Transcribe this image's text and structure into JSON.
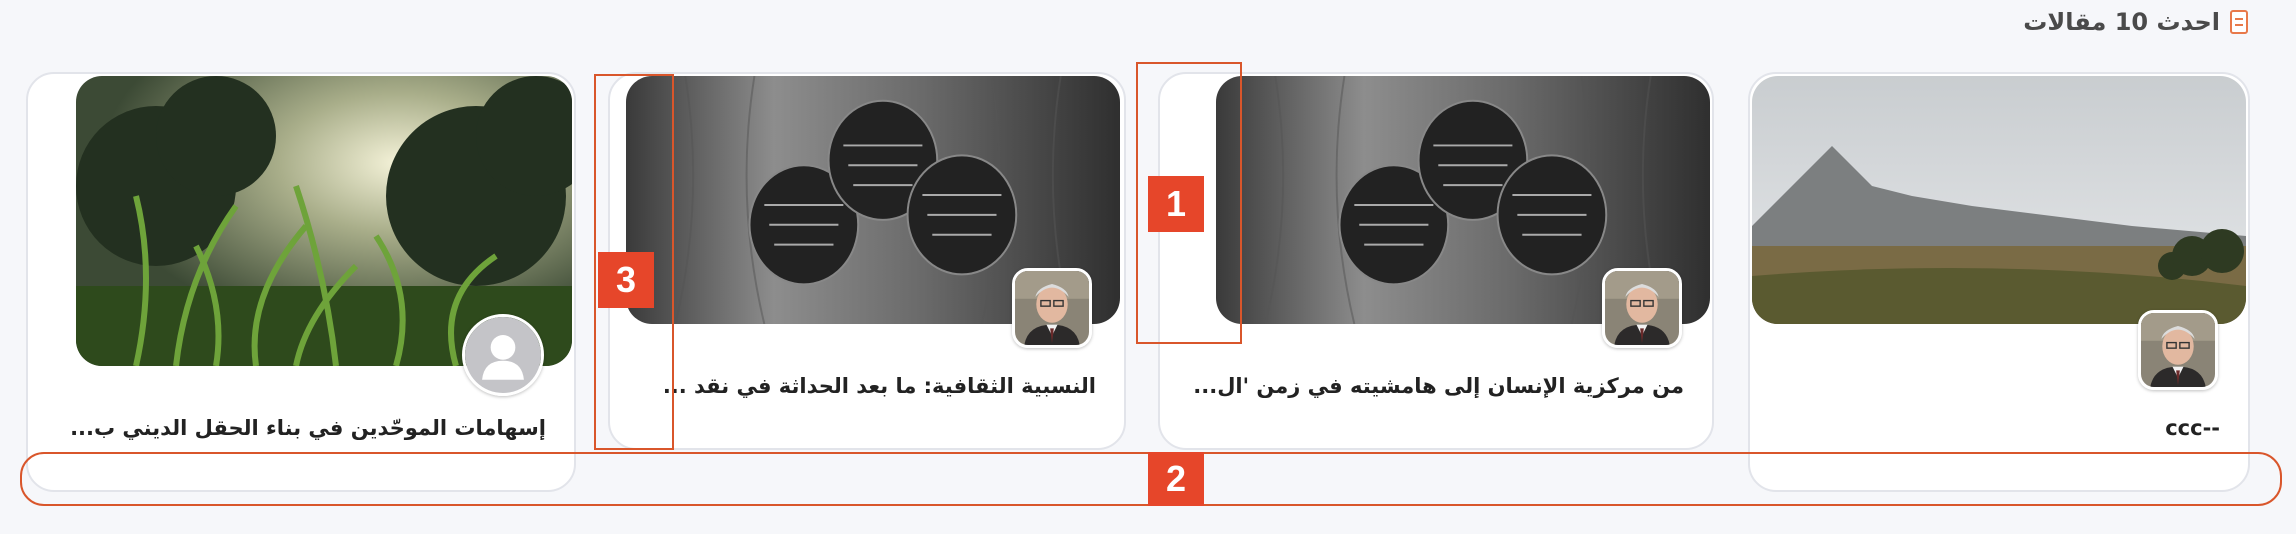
{
  "section": {
    "title": "احدث 10 مقالات",
    "icon": "document-icon"
  },
  "articles": [
    {
      "title": "--ccc",
      "image": "mountain-valley-image",
      "avatar": "author-photo"
    },
    {
      "title": "من مركزية الإنسان إلى هامشيته في زمن 'ال...",
      "image": "pinecones-image",
      "avatar": "author-photo"
    },
    {
      "title": "النسبية الثقافية: ما بعد الحداثة في نقد ...",
      "image": "pinecones-image",
      "avatar": "author-photo"
    },
    {
      "title": "إسهامات الموحّدين في بناء الحقل الديني ب...",
      "image": "grass-image",
      "avatar": "default-user-avatar"
    }
  ],
  "annotations": [
    {
      "label": "1"
    },
    {
      "label": "2"
    },
    {
      "label": "3"
    }
  ],
  "colors": {
    "accent": "#e6462a",
    "outline": "#d9562b",
    "card_border": "#e2e4ea"
  }
}
